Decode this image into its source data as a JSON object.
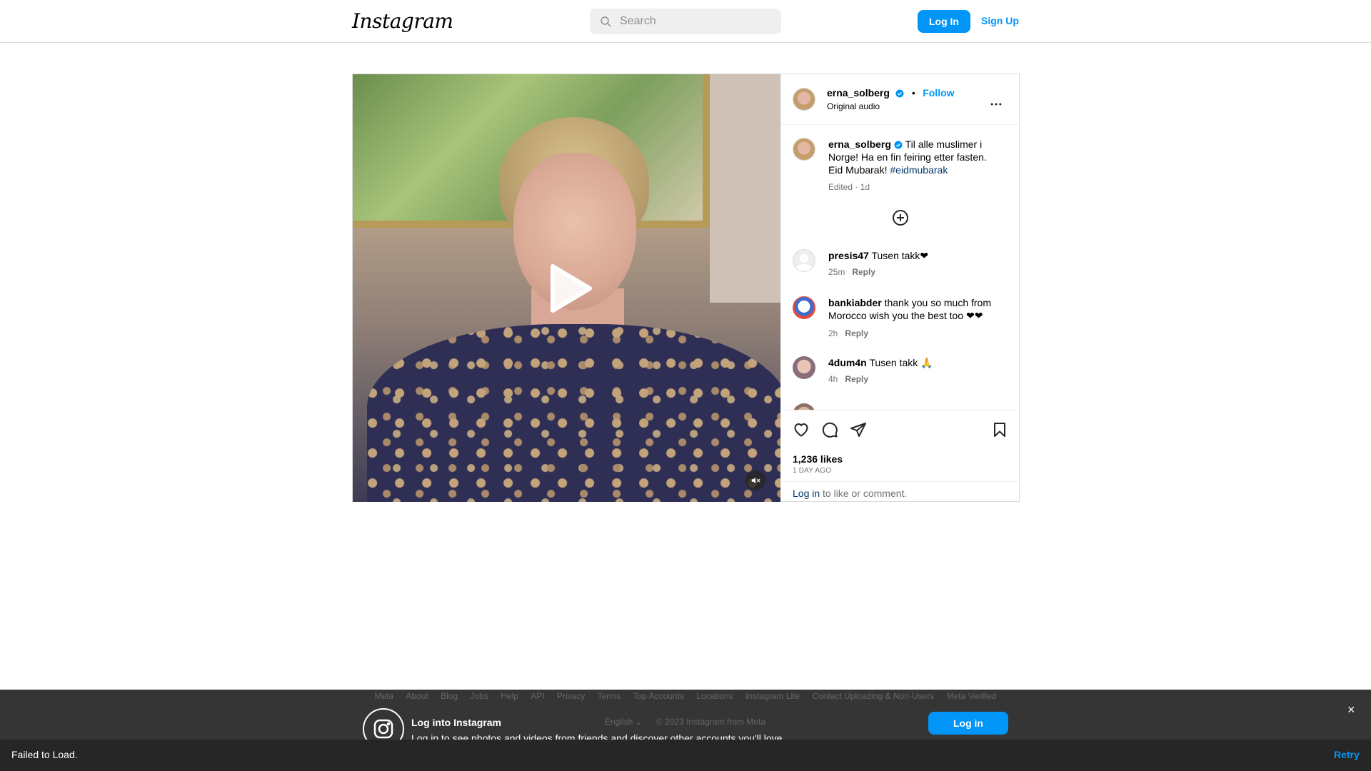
{
  "header": {
    "logo": "Instagram",
    "search_placeholder": "Search",
    "login_label": "Log In",
    "signup_label": "Sign Up"
  },
  "post": {
    "author": "erna_solberg",
    "follow_label": "Follow",
    "separator": "•",
    "audio": "Original audio",
    "caption": {
      "user": "erna_solberg",
      "text": "Til alle muslimer i Norge! Ha en fin feiring etter fasten. Eid Mubarak!",
      "hashtag": "#eidmubarak",
      "meta": "Edited · 1d"
    },
    "comments": [
      {
        "user": "presis47",
        "text": "Tusen takk❤",
        "time": "25m",
        "reply": "Reply"
      },
      {
        "user": "bankiabder",
        "text": "thank you so much from Morocco wish you the best too ❤❤",
        "time": "2h",
        "reply": "Reply"
      },
      {
        "user": "4dum4n",
        "text": "Tusen takk 🙏",
        "time": "4h",
        "reply": "Reply"
      }
    ],
    "likes": "1,236 likes",
    "posted": "1 DAY AGO",
    "login_link": "Log in",
    "login_rest": " to like or comment."
  },
  "footer": {
    "links": [
      "Meta",
      "About",
      "Blog",
      "Jobs",
      "Help",
      "API",
      "Privacy",
      "Terms",
      "Top Accounts",
      "Locations",
      "Instagram Lite",
      "Contact Uploading & Non-Users",
      "Meta Verified"
    ],
    "language": "English",
    "copyright": "© 2023 Instagram from Meta"
  },
  "banner": {
    "title": "Log into Instagram",
    "subtitle": "Log in to see photos and videos from friends and discover other accounts you'll love.",
    "login_label": "Log in",
    "close": "×"
  },
  "toast": {
    "message": "Failed to Load.",
    "retry": "Retry"
  },
  "colors": {
    "accent": "#0095f6",
    "link_dark": "#00376b",
    "muted": "#737373",
    "border": "#dbdbdb",
    "banner_bg": "#262626"
  }
}
